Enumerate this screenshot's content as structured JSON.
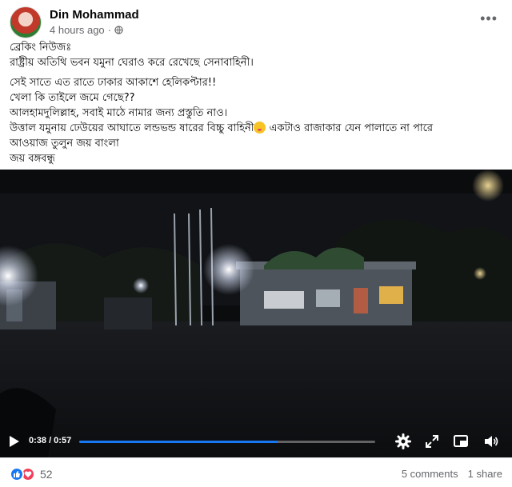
{
  "post": {
    "author": "Din Mohammad",
    "timestamp": "4 hours ago",
    "separator": "·",
    "privacy_icon": "globe-icon",
    "more_icon": "more-options-icon"
  },
  "text": {
    "p1": [
      "ব্রেকিং নিউজঃ",
      "রাষ্ট্রীয় অতিথি ভবন যমুনা ঘেরাও করে রেখেছে সেনাবাহিনী।"
    ],
    "p2": [
      "সেই সাতে এত রাতে ঢাকার আকাশে হেলিকপ্টার!!",
      "খেলা কি তাইলে জমে গেছে??",
      "আলহামদুলিল্লাহ, সবাই মাঠে নামার জন্য প্রস্তুতি নাও।"
    ],
    "p2_line4_a": "উত্তাল যমুনায় ঢেউয়ের আঘাতে লন্ডভন্ড ষারের বিচ্চু বাহিনী",
    "p2_line4_b": " একটাও রাজাকার যেন পালাতে না পারে",
    "p2_rest": [
      "আওয়াজ তুলুন জয় বাংলা",
      "জয় বঙ্গবন্ধু"
    ]
  },
  "video": {
    "time": "0:38 / 0:57",
    "progress": 0.67,
    "accent": "#1877f2"
  },
  "footer": {
    "reaction_count": "52",
    "comments": "5 comments",
    "shares": "1 share"
  }
}
